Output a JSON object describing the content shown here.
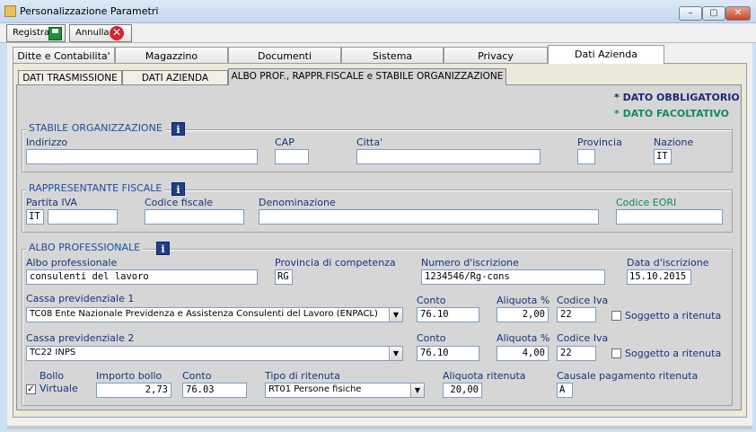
{
  "window": {
    "title": "Personalizzazione Parametri"
  },
  "toolbar": {
    "save_label": "Registra",
    "cancel_label": "Annulla"
  },
  "tabs": [
    "Ditte e Contabilita'",
    "Magazzino",
    "Documenti",
    "Sistema",
    "Privacy",
    "Dati Azienda"
  ],
  "subtabs": [
    "DATI TRASMISSIONE",
    "DATI AZIENDA",
    "ALBO PROF., RAPPR.FISCALE e STABILE ORGANIZZAZIONE"
  ],
  "legend": {
    "required": "* DATO OBBLIGATORIO",
    "optional": "* DATO FACOLTATIVO"
  },
  "stabile": {
    "title": "STABILE ORGANIZZAZIONE",
    "indirizzo_label": "Indirizzo",
    "cap_label": "CAP",
    "citta_label": "Citta'",
    "provincia_label": "Provincia",
    "nazione_label": "Nazione",
    "indirizzo": "",
    "cap": "",
    "citta": "",
    "provincia": "",
    "nazione": "IT"
  },
  "rappresentante": {
    "title": "RAPPRESENTANTE FISCALE",
    "piva_label": "Partita IVA",
    "cf_label": "Codice fiscale",
    "denom_label": "Denominazione",
    "eori_label": "Codice EORI",
    "piva_country": "IT",
    "piva": "",
    "cf": "",
    "denominazione": "",
    "eori": ""
  },
  "albo": {
    "title": "ALBO PROFESSIONALE",
    "albo_label": "Albo professionale",
    "albo": "consulenti del lavoro",
    "prov_label": "Provincia di competenza",
    "prov": "RG",
    "num_label": "Numero d'iscrizione",
    "num": "1234546/Rg-cons",
    "data_label": "Data d'iscrizione",
    "data": "15.10.2015",
    "cassa1_label": "Cassa previdenziale 1",
    "cassa1": "TC08 Ente Nazionale Previdenza e Assistenza Consulenti del Lavoro (ENPACL)",
    "cassa2_label": "Cassa previdenziale 2",
    "cassa2": "TC22 INPS",
    "conto_label": "Conto",
    "aliquota_label": "Aliquota %",
    "codiva_label": "Codice Iva",
    "ritenuta_label": "Soggetto a ritenuta",
    "conto1": "76.10",
    "aliquota1": "2,00",
    "codiva1": "22",
    "conto2": "76.10",
    "aliquota2": "4,00",
    "codiva2": "22",
    "bollo_label": "Bollo",
    "virtuale_label": "Virtuale",
    "importo_label": "Importo bollo",
    "importo": "2,73",
    "conto_bollo": "76.03",
    "tipo_rit_label": "Tipo di ritenuta",
    "tipo_rit": "RT01 Persone fisiche",
    "aliq_rit_label": "Aliquota ritenuta",
    "aliq_rit": "20,00",
    "causale_label": "Causale pagamento ritenuta",
    "causale": "A"
  }
}
